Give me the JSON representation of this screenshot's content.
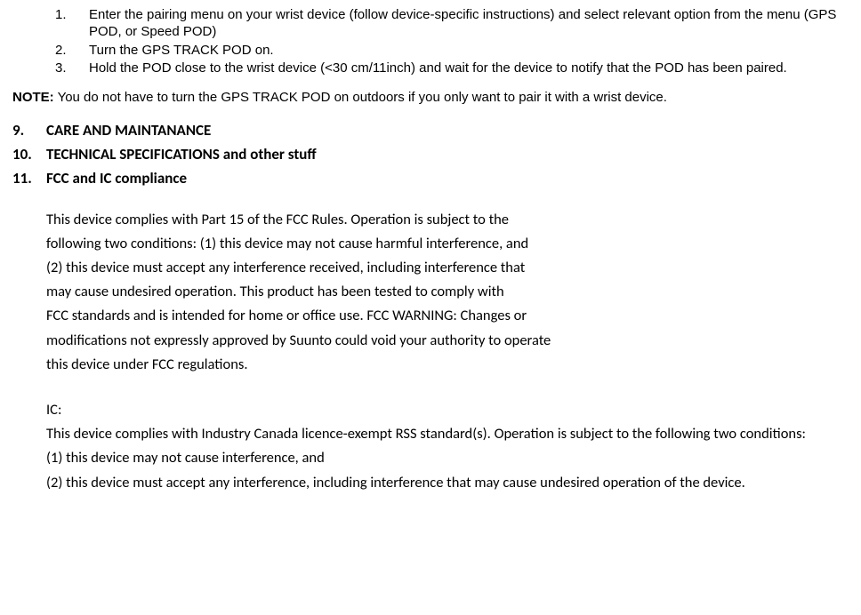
{
  "steps": [
    {
      "num": "1.",
      "text": "Enter the pairing menu on your wrist device (follow device-specific instructions) and select relevant option from the menu (GPS POD, or Speed POD)"
    },
    {
      "num": "2.",
      "text": "Turn the GPS TRACK POD on."
    },
    {
      "num": "3.",
      "text": "Hold the POD close to the wrist device (<30 cm/11inch) and wait for the device to notify that the POD has been paired."
    }
  ],
  "note": {
    "label": "NOTE:",
    "text": " You do not have to turn the GPS TRACK POD on outdoors if you only want to pair it with a wrist device."
  },
  "headings": [
    {
      "num": "9.",
      "text": "CARE AND MAINTANANCE"
    },
    {
      "num": "10.",
      "text": "TECHNICAL SPECIFICATIONS and other stuff"
    },
    {
      "num": "11.",
      "text": "FCC and IC  compliance"
    }
  ],
  "fcc": {
    "l1": "This device complies with Part 15 of the FCC Rules. Operation is subject to the",
    "l2": "following two conditions: (1) this device may not cause harmful interference, and",
    "l3": "(2) this device must accept any interference received, including interference that",
    "l4": "may cause undesired operation. This product has been tested to comply with",
    "l5": "FCC standards and is intended for home or office use. FCC WARNING: Changes or",
    "l6": "modifications not expressly approved by Suunto could void your authority to operate",
    "l7": "this device under FCC regulations."
  },
  "ic": {
    "l1": "IC:",
    "l2": "This device complies with Industry Canada licence-exempt RSS standard(s). Operation is subject to the following two conditions:",
    "l3": "(1) this device may not cause interference, and",
    "l4": "(2) this device must accept any interference, including interference that may cause undesired operation of the device."
  }
}
